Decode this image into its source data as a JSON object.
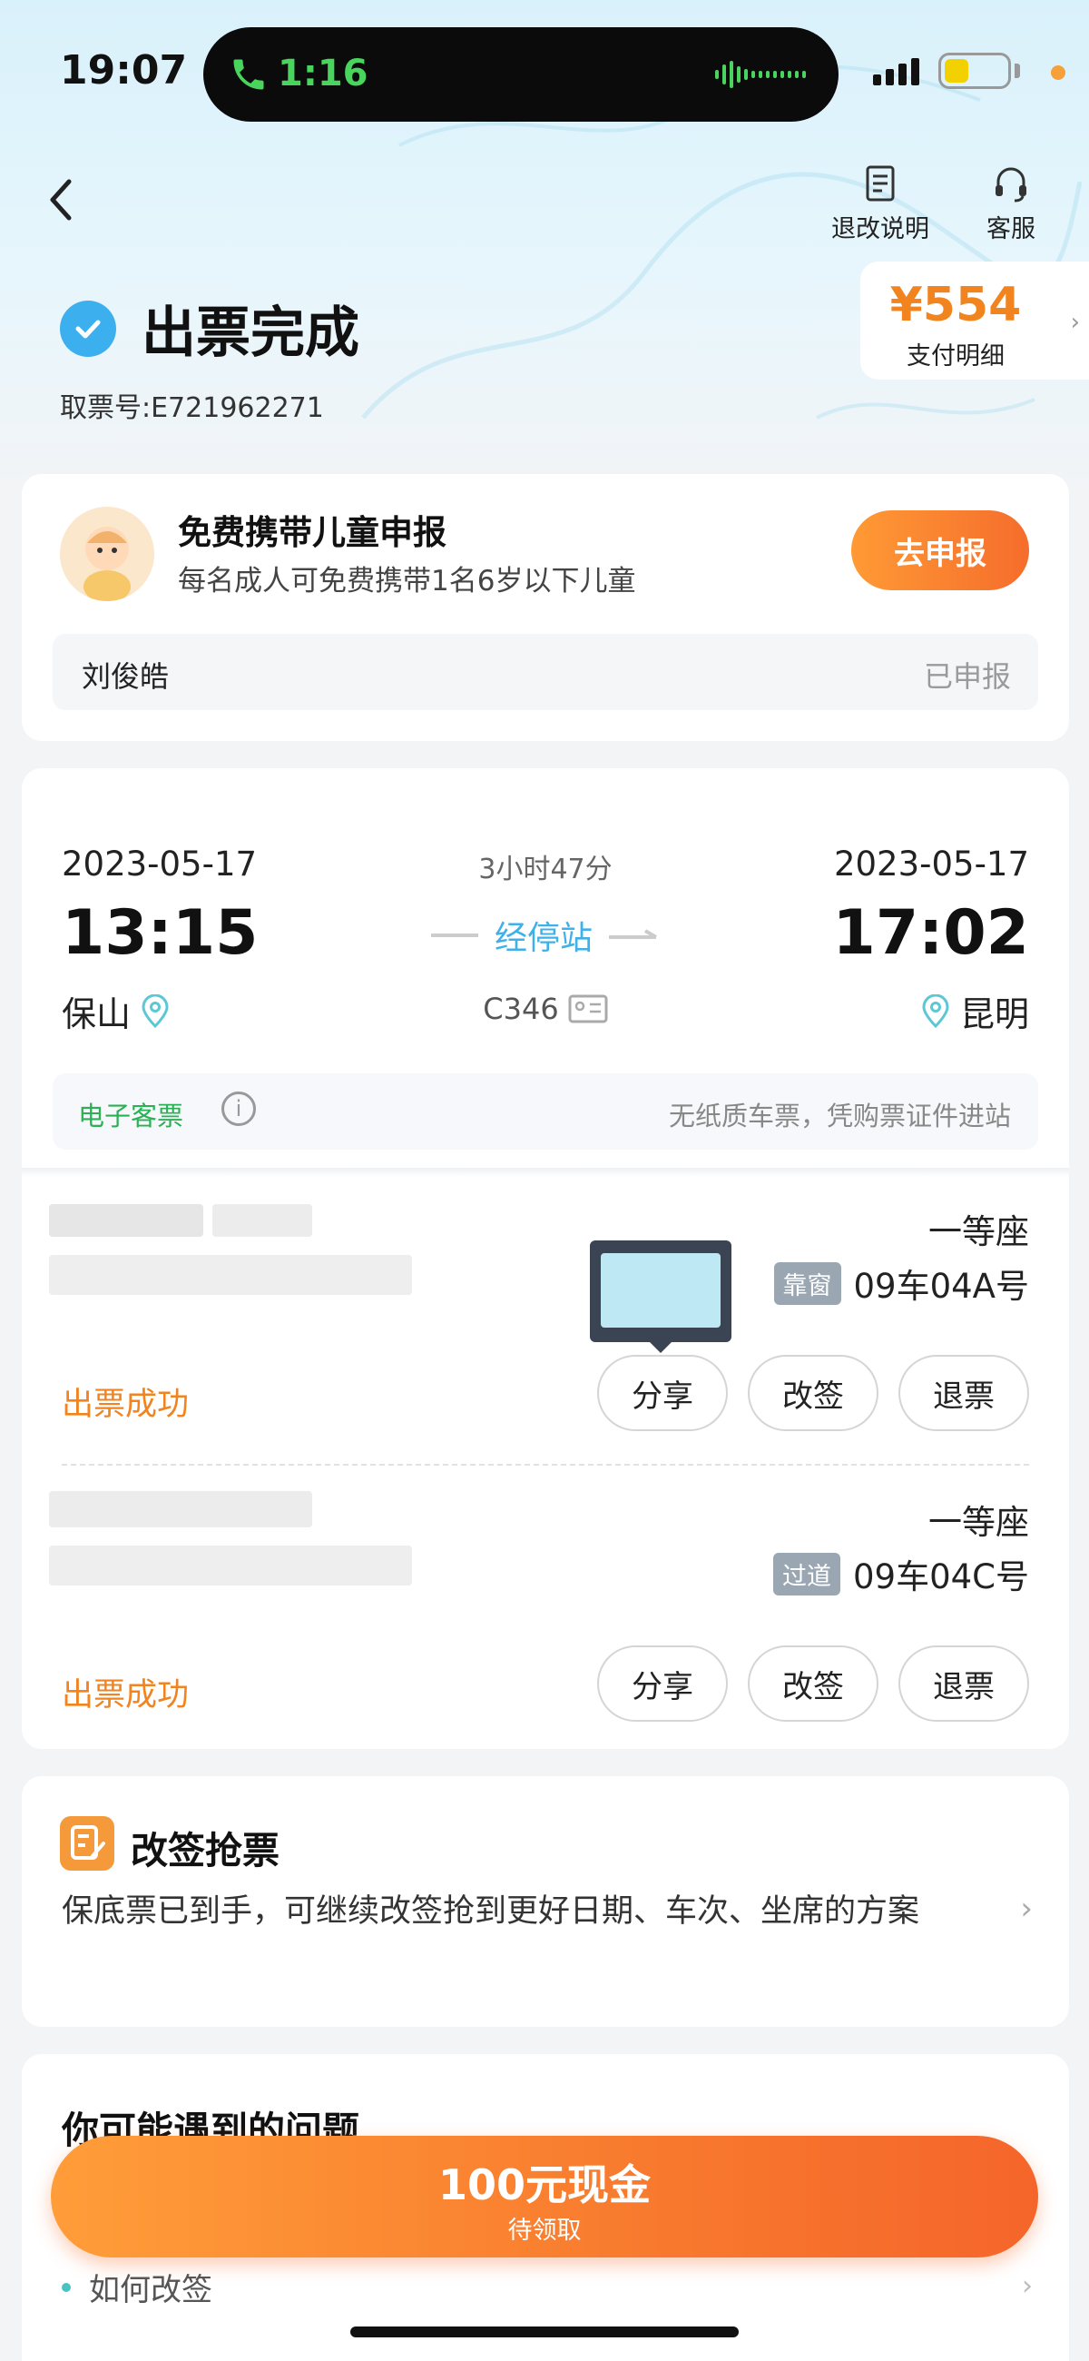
{
  "status_bar": {
    "time": "19:07",
    "call_time": "1:16"
  },
  "nav": {
    "refund_info_label": "退改说明",
    "service_label": "客服"
  },
  "header": {
    "title": "出票完成",
    "ticket_number": "取票号:E721962271"
  },
  "price": {
    "amount": "¥554",
    "label": "支付明细"
  },
  "child_declare": {
    "title": "免费携带儿童申报",
    "subtitle": "每名成人可免费携带1名6岁以下儿童",
    "button_label": "去申报",
    "name": "刘俊皓",
    "state": "已申报"
  },
  "trip": {
    "departure": {
      "date": "2023-05-17",
      "time": "13:15",
      "station": "保山"
    },
    "arrival": {
      "date": "2023-05-17",
      "time": "17:02",
      "station": "昆明"
    },
    "duration": "3小时47分",
    "stops_label": "经停站",
    "train_no": "C346",
    "eticket_label": "电子客票",
    "eticket_note": "无纸质车票，凭购票证件进站"
  },
  "passengers": [
    {
      "seat_class": "一等座",
      "seat_tag": "靠窗",
      "seat_no": "09车04A号",
      "status": "出票成功",
      "buttons": {
        "share": "分享",
        "change": "改签",
        "refund": "退票"
      }
    },
    {
      "seat_class": "一等座",
      "seat_tag": "过道",
      "seat_no": "09车04C号",
      "status": "出票成功",
      "buttons": {
        "share": "分享",
        "change": "改签",
        "refund": "退票"
      }
    }
  ],
  "change_grab": {
    "title": "改签抢票",
    "description": "保底票已到手，可继续改签抢到更好日期、车次、坐席的方案"
  },
  "faq": {
    "title": "你可能遇到的问题",
    "items": [
      "如何改签"
    ]
  },
  "cash_banner": {
    "title": "100元现金",
    "subtitle": "待领取"
  },
  "colors": {
    "accent_orange": "#f1841f",
    "link_blue": "#3fb1e8",
    "success_green": "#2ab154"
  }
}
